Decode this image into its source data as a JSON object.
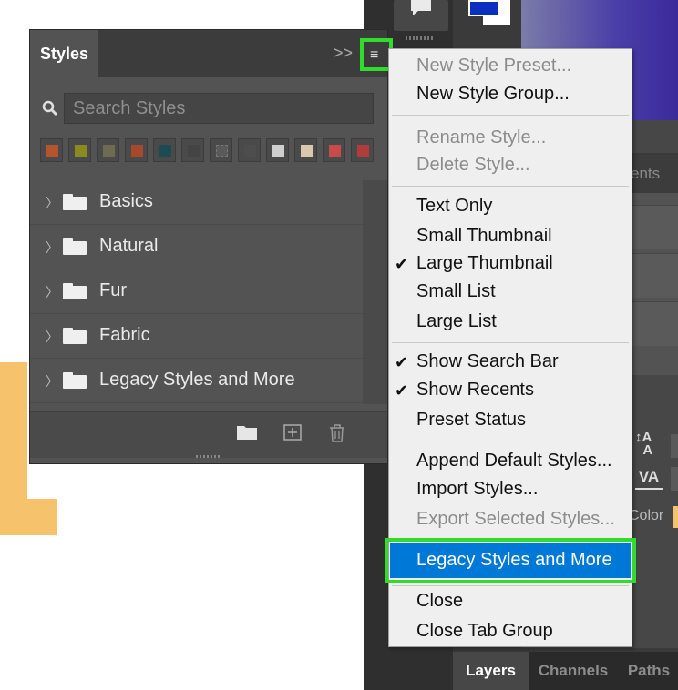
{
  "styles_panel": {
    "tab_label": "Styles",
    "collapse_glyph": ">>",
    "search": {
      "placeholder": "Search Styles"
    },
    "thumbnails": [
      {
        "icon": "style-thumb-1",
        "color": "#b5552f"
      },
      {
        "icon": "style-thumb-2",
        "color": "#8b8a1f"
      },
      {
        "icon": "style-thumb-3",
        "color": "#6f6a52"
      },
      {
        "icon": "style-thumb-4",
        "color": "#a6482b"
      },
      {
        "icon": "style-thumb-5",
        "color": "#1d4b52"
      },
      {
        "icon": "style-thumb-6",
        "color": "#444444"
      },
      {
        "icon": "style-thumb-7",
        "color": "#5a5a5a"
      },
      {
        "icon": "style-thumb-8",
        "color": "#4d4d4d"
      },
      {
        "icon": "style-thumb-9",
        "color": "#cfcfcf"
      },
      {
        "icon": "style-thumb-10",
        "color": "#d9c7b0"
      },
      {
        "icon": "style-thumb-11",
        "color": "#c94a4a"
      },
      {
        "icon": "style-thumb-12",
        "color": "#b23c3c"
      }
    ],
    "groups": [
      {
        "label": "Basics"
      },
      {
        "label": "Natural"
      },
      {
        "label": "Fur"
      },
      {
        "label": "Fabric"
      },
      {
        "label": "Legacy Styles and More"
      }
    ]
  },
  "menu": {
    "new_style_preset": "New Style Preset...",
    "new_style_group": "New Style Group...",
    "rename_style": "Rename Style...",
    "delete_style": "Delete Style...",
    "text_only": "Text Only",
    "small_thumbnail": "Small Thumbnail",
    "large_thumbnail": "Large Thumbnail",
    "small_list": "Small List",
    "large_list": "Large List",
    "show_search_bar": "Show Search Bar",
    "show_recents": "Show Recents",
    "preset_status": "Preset Status",
    "append_default_styles": "Append Default Styles...",
    "import_styles": "Import Styles...",
    "export_selected_styles": "Export Selected Styles...",
    "legacy_styles_and_more": "Legacy Styles and More",
    "close": "Close",
    "close_tab_group": "Close Tab Group",
    "check_glyph": "✔"
  },
  "dock": {
    "partial_tab": "ents",
    "color_label": "Color",
    "bottom_tabs": [
      "Layers",
      "Channels",
      "Paths"
    ],
    "foreground_color": "#0b2fc0",
    "highlight_color": "#31dc2d",
    "selection_color": "#0078d7"
  }
}
